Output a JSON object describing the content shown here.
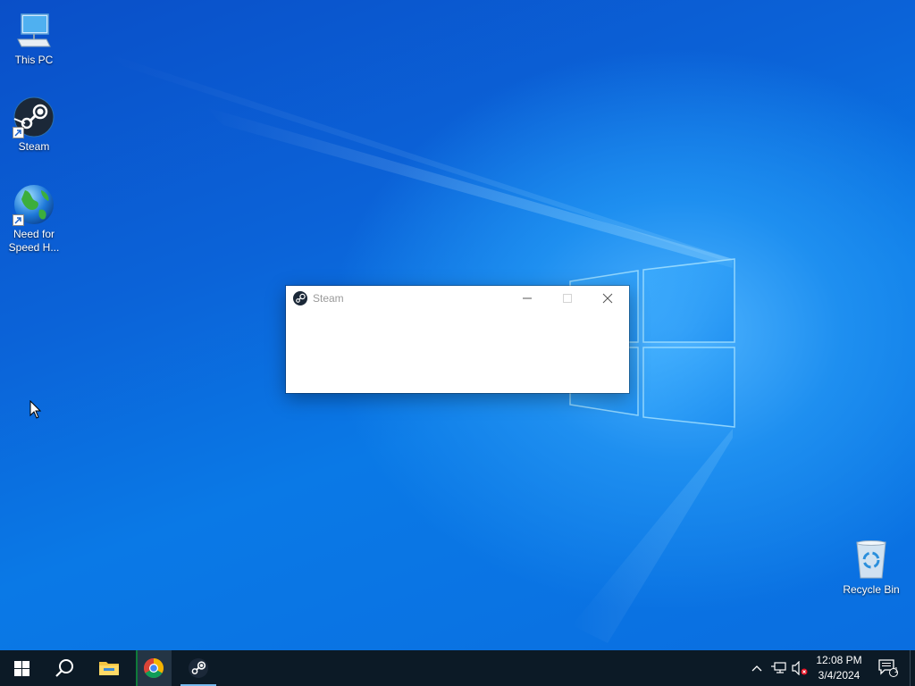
{
  "desktop": {
    "icons": [
      {
        "label": "This PC",
        "icon": "computer-icon"
      },
      {
        "label": "Steam",
        "icon": "steam-icon"
      },
      {
        "label": "Need for Speed H...",
        "icon": "globe-icon"
      },
      {
        "label": "Recycle Bin",
        "icon": "recycle-bin-icon"
      }
    ]
  },
  "steam_window": {
    "title": "Steam",
    "buttons": [
      "minimize",
      "maximize",
      "close"
    ]
  },
  "taskbar": {
    "apps": [
      {
        "name": "start",
        "icon": "windows-logo-icon"
      },
      {
        "name": "search",
        "icon": "search-icon"
      },
      {
        "name": "file-explorer",
        "icon": "folder-icon"
      },
      {
        "name": "chrome",
        "icon": "chrome-icon",
        "active": true
      },
      {
        "name": "steam",
        "icon": "steam-icon",
        "running": true
      }
    ],
    "tray": {
      "time": "12:08 PM",
      "date": "3/4/2024",
      "notifications": "1"
    }
  },
  "colors": {
    "desktop_blue": "#0a6ee0",
    "taskbar": "#0c1a26",
    "accent": "#76b9ed"
  }
}
